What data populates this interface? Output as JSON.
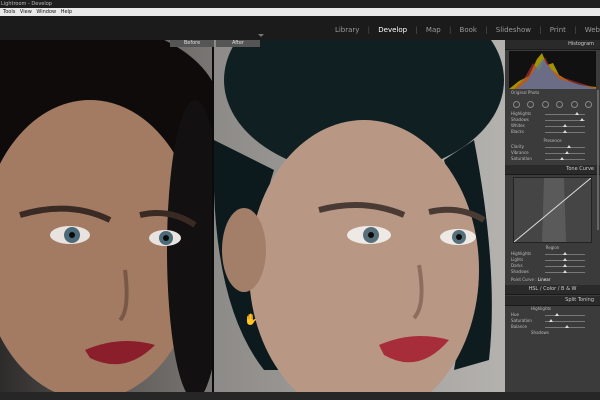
{
  "window": {
    "title": "Lightroom - Develop"
  },
  "menu": [
    "Tools",
    "View",
    "Window",
    "Help"
  ],
  "modules": [
    {
      "label": "Library",
      "active": false
    },
    {
      "label": "Develop",
      "active": true
    },
    {
      "label": "Map",
      "active": false
    },
    {
      "label": "Book",
      "active": false
    },
    {
      "label": "Slideshow",
      "active": false
    },
    {
      "label": "Print",
      "active": false
    },
    {
      "label": "Web",
      "active": false
    }
  ],
  "viewer": {
    "before_label": "Before",
    "after_label": "After"
  },
  "panel": {
    "histogram_title": "Histogram",
    "original_photo": "Original Photo",
    "tone_section_rows": [
      "Highlights",
      "Shadows",
      "Whites",
      "Blacks"
    ],
    "presence_title": "Presence",
    "presence_rows": [
      "Clarity",
      "Vibrance",
      "Saturation"
    ],
    "tone_curve_title": "Tone Curve",
    "region_title": "Region",
    "region_rows": [
      "Highlights",
      "Lights",
      "Darks",
      "Shadows"
    ],
    "point_curve_label": "Point Curve :",
    "point_curve_value": "Linear",
    "hsl_tabs": [
      "HSL",
      "Color",
      "B & W"
    ],
    "split_toning_title": "Split Toning",
    "split_toning_rows": [
      "Highlights",
      "Hue",
      "Saturation",
      "Balance",
      "Shadows"
    ]
  }
}
